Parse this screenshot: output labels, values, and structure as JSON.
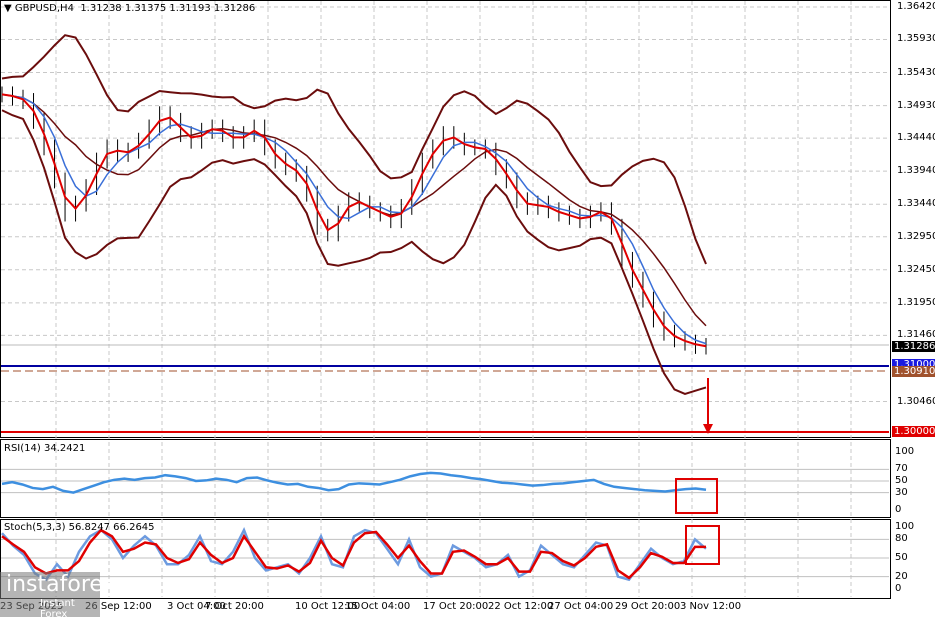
{
  "header": {
    "symbol": "GBPUSD,H4",
    "ohlc": "1.31238 1.31375 1.31193 1.31286"
  },
  "price_axis": [
    "1.36420",
    "1.35930",
    "1.35430",
    "1.34930",
    "1.34440",
    "1.33940",
    "1.33440",
    "1.32950",
    "1.32450",
    "1.31950",
    "1.31460",
    "1.30460"
  ],
  "tags": {
    "current": "1.31286",
    "blue_level": "1.31000",
    "brown_level": "1.30910",
    "target": "1.30000"
  },
  "colors": {
    "candles": "#000000",
    "bands": "#6b0d0d",
    "ma_fast": "#e00000",
    "ma_slow": "#3a6fd8",
    "rsi": "#3d8fe0",
    "stoch_main": "#6d9be0",
    "stoch_signal": "#e00000",
    "box": "#e00000",
    "blue_line": "#0000a0",
    "red_line": "#e00000"
  },
  "rsi": {
    "label": "RSI(14) 34.2421",
    "levels": [
      "100",
      "70",
      "50",
      "30",
      "0"
    ]
  },
  "stoch": {
    "label": "Stoch(5,3,3) 56.8247 66.2645",
    "levels": [
      "100",
      "80",
      "50",
      "20",
      "0"
    ]
  },
  "time_axis": [
    "23 Sep 2025",
    "26 Sep 12:00",
    "3 Oct 04:00",
    "7 Oct 20:00",
    "10 Oct 12:00",
    "15 Oct 04:00",
    "17 Oct 20:00",
    "22 Oct 12:00",
    "27 Oct 04:00",
    "29 Oct 20:00",
    "3 Nov 12:00"
  ],
  "watermark": {
    "brand": "instaforex",
    "tagline": "Instant Forex Trading"
  },
  "chart_data": {
    "type": "line",
    "title": "GBPUSD,H4",
    "ylim": [
      1.2995,
      1.3648
    ],
    "close": [
      1.351,
      1.3505,
      1.35,
      1.347,
      1.343,
      1.338,
      1.333,
      1.3345,
      1.337,
      1.341,
      1.343,
      1.342,
      1.3425,
      1.344,
      1.346,
      1.348,
      1.347,
      1.345,
      1.344,
      1.3455,
      1.346,
      1.345,
      1.344,
      1.345,
      1.346,
      1.343,
      1.341,
      1.34,
      1.339,
      1.336,
      1.331,
      1.33,
      1.333,
      1.335,
      1.3345,
      1.3335,
      1.333,
      1.332,
      1.334,
      1.337,
      1.341,
      1.343,
      1.345,
      1.344,
      1.343,
      1.343,
      1.3425,
      1.34,
      1.338,
      1.335,
      1.334,
      1.3345,
      1.3335,
      1.333,
      1.3325,
      1.332,
      1.333,
      1.3335,
      1.331,
      1.326,
      1.323,
      1.32,
      1.317,
      1.315,
      1.314,
      1.3135,
      1.313,
      1.3129
    ],
    "rsi": [
      45,
      48,
      44,
      38,
      36,
      40,
      33,
      30,
      36,
      42,
      48,
      52,
      54,
      52,
      55,
      56,
      60,
      58,
      55,
      50,
      51,
      54,
      52,
      48,
      55,
      56,
      51,
      47,
      44,
      45,
      40,
      38,
      34,
      36,
      44,
      46,
      45,
      44,
      48,
      52,
      58,
      62,
      64,
      63,
      60,
      58,
      55,
      53,
      50,
      47,
      46,
      44,
      42,
      43,
      45,
      46,
      48,
      50,
      52,
      45,
      40,
      38,
      36,
      34,
      33,
      32,
      34,
      36,
      37,
      35
    ],
    "stoch_k": [
      90,
      70,
      55,
      25,
      15,
      40,
      20,
      60,
      85,
      95,
      80,
      50,
      70,
      85,
      70,
      40,
      40,
      55,
      85,
      45,
      40,
      60,
      95,
      50,
      30,
      35,
      40,
      25,
      50,
      85,
      40,
      35,
      85,
      95,
      90,
      65,
      40,
      80,
      35,
      20,
      25,
      70,
      60,
      50,
      35,
      40,
      55,
      20,
      30,
      70,
      55,
      40,
      35,
      55,
      75,
      70,
      20,
      15,
      40,
      65,
      50,
      40,
      45,
      80,
      65
    ],
    "stoch_d": [
      85,
      72,
      60,
      35,
      25,
      30,
      30,
      45,
      75,
      95,
      85,
      60,
      65,
      75,
      72,
      50,
      42,
      48,
      75,
      55,
      42,
      50,
      85,
      60,
      35,
      33,
      38,
      28,
      42,
      78,
      50,
      38,
      75,
      90,
      92,
      72,
      50,
      70,
      45,
      25,
      25,
      60,
      62,
      52,
      40,
      40,
      50,
      28,
      28,
      60,
      58,
      45,
      38,
      50,
      68,
      72,
      30,
      18,
      35,
      58,
      52,
      42,
      42,
      68,
      68
    ]
  }
}
